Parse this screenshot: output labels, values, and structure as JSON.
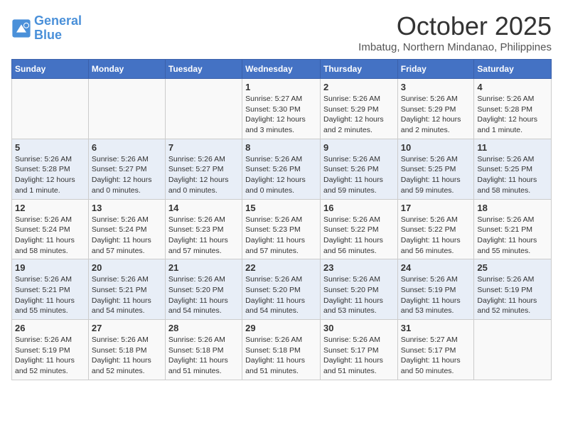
{
  "header": {
    "logo_line1": "General",
    "logo_line2": "Blue",
    "month": "October 2025",
    "location": "Imbatug, Northern Mindanao, Philippines"
  },
  "weekdays": [
    "Sunday",
    "Monday",
    "Tuesday",
    "Wednesday",
    "Thursday",
    "Friday",
    "Saturday"
  ],
  "weeks": [
    [
      {
        "day": "",
        "info": ""
      },
      {
        "day": "",
        "info": ""
      },
      {
        "day": "",
        "info": ""
      },
      {
        "day": "1",
        "info": "Sunrise: 5:27 AM\nSunset: 5:30 PM\nDaylight: 12 hours and 3 minutes."
      },
      {
        "day": "2",
        "info": "Sunrise: 5:26 AM\nSunset: 5:29 PM\nDaylight: 12 hours and 2 minutes."
      },
      {
        "day": "3",
        "info": "Sunrise: 5:26 AM\nSunset: 5:29 PM\nDaylight: 12 hours and 2 minutes."
      },
      {
        "day": "4",
        "info": "Sunrise: 5:26 AM\nSunset: 5:28 PM\nDaylight: 12 hours and 1 minute."
      }
    ],
    [
      {
        "day": "5",
        "info": "Sunrise: 5:26 AM\nSunset: 5:28 PM\nDaylight: 12 hours and 1 minute."
      },
      {
        "day": "6",
        "info": "Sunrise: 5:26 AM\nSunset: 5:27 PM\nDaylight: 12 hours and 0 minutes."
      },
      {
        "day": "7",
        "info": "Sunrise: 5:26 AM\nSunset: 5:27 PM\nDaylight: 12 hours and 0 minutes."
      },
      {
        "day": "8",
        "info": "Sunrise: 5:26 AM\nSunset: 5:26 PM\nDaylight: 12 hours and 0 minutes."
      },
      {
        "day": "9",
        "info": "Sunrise: 5:26 AM\nSunset: 5:26 PM\nDaylight: 11 hours and 59 minutes."
      },
      {
        "day": "10",
        "info": "Sunrise: 5:26 AM\nSunset: 5:25 PM\nDaylight: 11 hours and 59 minutes."
      },
      {
        "day": "11",
        "info": "Sunrise: 5:26 AM\nSunset: 5:25 PM\nDaylight: 11 hours and 58 minutes."
      }
    ],
    [
      {
        "day": "12",
        "info": "Sunrise: 5:26 AM\nSunset: 5:24 PM\nDaylight: 11 hours and 58 minutes."
      },
      {
        "day": "13",
        "info": "Sunrise: 5:26 AM\nSunset: 5:24 PM\nDaylight: 11 hours and 57 minutes."
      },
      {
        "day": "14",
        "info": "Sunrise: 5:26 AM\nSunset: 5:23 PM\nDaylight: 11 hours and 57 minutes."
      },
      {
        "day": "15",
        "info": "Sunrise: 5:26 AM\nSunset: 5:23 PM\nDaylight: 11 hours and 57 minutes."
      },
      {
        "day": "16",
        "info": "Sunrise: 5:26 AM\nSunset: 5:22 PM\nDaylight: 11 hours and 56 minutes."
      },
      {
        "day": "17",
        "info": "Sunrise: 5:26 AM\nSunset: 5:22 PM\nDaylight: 11 hours and 56 minutes."
      },
      {
        "day": "18",
        "info": "Sunrise: 5:26 AM\nSunset: 5:21 PM\nDaylight: 11 hours and 55 minutes."
      }
    ],
    [
      {
        "day": "19",
        "info": "Sunrise: 5:26 AM\nSunset: 5:21 PM\nDaylight: 11 hours and 55 minutes."
      },
      {
        "day": "20",
        "info": "Sunrise: 5:26 AM\nSunset: 5:21 PM\nDaylight: 11 hours and 54 minutes."
      },
      {
        "day": "21",
        "info": "Sunrise: 5:26 AM\nSunset: 5:20 PM\nDaylight: 11 hours and 54 minutes."
      },
      {
        "day": "22",
        "info": "Sunrise: 5:26 AM\nSunset: 5:20 PM\nDaylight: 11 hours and 54 minutes."
      },
      {
        "day": "23",
        "info": "Sunrise: 5:26 AM\nSunset: 5:20 PM\nDaylight: 11 hours and 53 minutes."
      },
      {
        "day": "24",
        "info": "Sunrise: 5:26 AM\nSunset: 5:19 PM\nDaylight: 11 hours and 53 minutes."
      },
      {
        "day": "25",
        "info": "Sunrise: 5:26 AM\nSunset: 5:19 PM\nDaylight: 11 hours and 52 minutes."
      }
    ],
    [
      {
        "day": "26",
        "info": "Sunrise: 5:26 AM\nSunset: 5:19 PM\nDaylight: 11 hours and 52 minutes."
      },
      {
        "day": "27",
        "info": "Sunrise: 5:26 AM\nSunset: 5:18 PM\nDaylight: 11 hours and 52 minutes."
      },
      {
        "day": "28",
        "info": "Sunrise: 5:26 AM\nSunset: 5:18 PM\nDaylight: 11 hours and 51 minutes."
      },
      {
        "day": "29",
        "info": "Sunrise: 5:26 AM\nSunset: 5:18 PM\nDaylight: 11 hours and 51 minutes."
      },
      {
        "day": "30",
        "info": "Sunrise: 5:26 AM\nSunset: 5:17 PM\nDaylight: 11 hours and 51 minutes."
      },
      {
        "day": "31",
        "info": "Sunrise: 5:27 AM\nSunset: 5:17 PM\nDaylight: 11 hours and 50 minutes."
      },
      {
        "day": "",
        "info": ""
      }
    ]
  ]
}
